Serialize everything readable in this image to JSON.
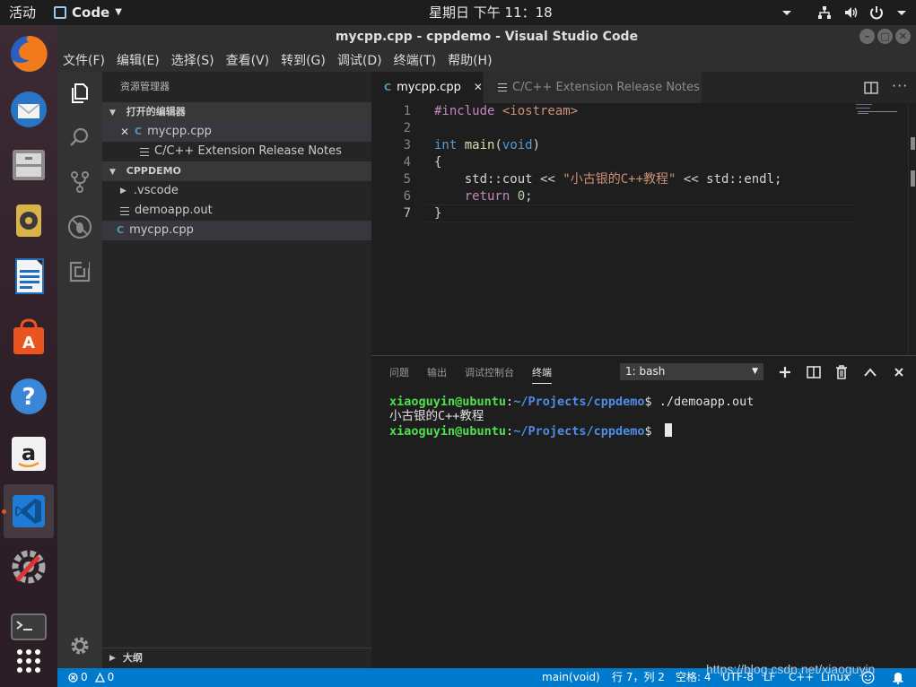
{
  "topbar": {
    "activities": "活动",
    "app_menu": "Code",
    "clock": "星期日 下午 11：18"
  },
  "window": {
    "title": "mycpp.cpp - cppdemo - Visual Studio Code"
  },
  "menu": [
    "文件(F)",
    "编辑(E)",
    "选择(S)",
    "查看(V)",
    "转到(G)",
    "调试(D)",
    "终端(T)",
    "帮助(H)"
  ],
  "dock": {
    "items": [
      {
        "name": "firefox-icon",
        "color": "#e66000"
      },
      {
        "name": "thunderbird-icon",
        "color": "#2a74c6"
      },
      {
        "name": "files-icon",
        "color": "#8c8c8c"
      },
      {
        "name": "rhythmbox-icon",
        "color": "#c9a33a"
      },
      {
        "name": "libreoffice-writer-icon",
        "color": "#1e6fbf"
      },
      {
        "name": "ubuntu-software-icon",
        "color": "#e95420"
      },
      {
        "name": "help-icon",
        "color": "#3b86d6"
      },
      {
        "name": "amazon-icon",
        "color": "#f2f2f2"
      },
      {
        "name": "vscode-icon",
        "color": "#1e7bd6"
      },
      {
        "name": "system-settings-icon",
        "color": "#9a9a9a"
      },
      {
        "name": "terminal-icon",
        "color": "#3b3b3b"
      },
      {
        "name": "show-applications-icon",
        "color": "#ffffff"
      }
    ]
  },
  "sidebar": {
    "title": "资源管理器",
    "open_editors_header": "打开的编辑器",
    "open_editors": [
      {
        "label": "mycpp.cpp",
        "close": "✕",
        "icon": "C"
      },
      {
        "label": "C/C++ Extension Release Notes"
      }
    ],
    "project_header": "CPPDEMO",
    "files": [
      {
        "label": ".vscode",
        "type": "folder"
      },
      {
        "label": "demoapp.out",
        "type": "file"
      },
      {
        "label": "mycpp.cpp",
        "type": "cpp"
      }
    ],
    "outline_header": "大纲"
  },
  "tabs": [
    {
      "label": "mycpp.cpp",
      "close": "✕"
    },
    {
      "label": "C/C++ Extension Release Notes"
    }
  ],
  "editor": {
    "line_numbers": [
      "1",
      "2",
      "3",
      "4",
      "5",
      "6",
      "7"
    ],
    "lines": [
      [
        {
          "t": "pp",
          "v": "#include "
        },
        {
          "t": "inc",
          "v": "<iostream>"
        }
      ],
      [],
      [
        {
          "t": "kw",
          "v": "int"
        },
        {
          "t": "txt",
          "v": " "
        },
        {
          "t": "fn",
          "v": "main"
        },
        {
          "t": "txt",
          "v": "("
        },
        {
          "t": "kw",
          "v": "void"
        },
        {
          "t": "txt",
          "v": ")"
        }
      ],
      [
        {
          "t": "txt",
          "v": "{"
        }
      ],
      [
        {
          "t": "txt",
          "v": "    std::cout << "
        },
        {
          "t": "str",
          "v": "\"小古银的C++教程\""
        },
        {
          "t": "txt",
          "v": " << std::endl;"
        }
      ],
      [
        {
          "t": "txt",
          "v": "    "
        },
        {
          "t": "pp",
          "v": "return"
        },
        {
          "t": "txt",
          "v": " "
        },
        {
          "t": "num",
          "v": "0"
        },
        {
          "t": "txt",
          "v": ";"
        }
      ],
      [
        {
          "t": "txt",
          "v": "}"
        }
      ]
    ]
  },
  "panel": {
    "tabs": [
      "问题",
      "输出",
      "调试控制台",
      "终端"
    ],
    "terminal_select": "1: bash",
    "terminal": {
      "user": "xiaoguyin@ubuntu",
      "path": "~/Projects/cppdemo",
      "prompt_suffix": "$ ",
      "command": "./demoapp.out",
      "output": "小古银的C++教程",
      "colon": ":"
    }
  },
  "statusbar": {
    "errors": "0",
    "warnings": "0",
    "scope": "main(void)",
    "position": "行 7，列 2",
    "spaces": "空格: 4",
    "encoding": "UTF-8",
    "eol": "LF",
    "language": "C++",
    "platform": "Linux"
  },
  "watermark": "https://blog.csdn.net/xiaoguyin",
  "colors": {
    "accent": "#007acc",
    "editor_bg": "#1e1e1e",
    "sidebar_bg": "#252526",
    "activitybar_bg": "#333333",
    "ubuntu_orange": "#e95420"
  }
}
